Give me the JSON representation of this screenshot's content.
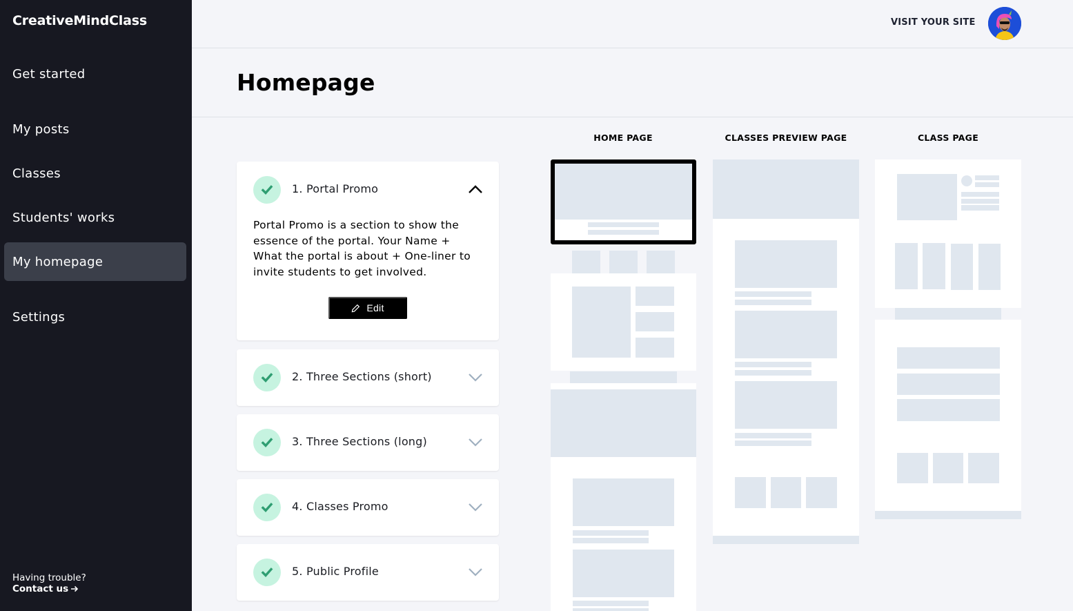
{
  "sidebar": {
    "brand": "CreativeMindClass",
    "items": [
      {
        "label": "Get started",
        "active": false
      },
      {
        "label": "My posts",
        "active": false
      },
      {
        "label": "Classes",
        "active": false
      },
      {
        "label": "Students' works",
        "active": false
      },
      {
        "label": "My homepage",
        "active": true
      },
      {
        "label": "Settings",
        "active": false
      }
    ],
    "help_text": "Having trouble?",
    "contact_label": "Contact us"
  },
  "topbar": {
    "visit_site_label": "VISIT YOUR SITE",
    "avatar_alt": "User avatar"
  },
  "page": {
    "title": "Homepage"
  },
  "sections": [
    {
      "title": "1. Portal Promo",
      "completed": true,
      "expanded": true,
      "description": "Portal Promo is a section to show the essence of the portal. Your Name + What the portal is about + One-liner to invite students to get involved.",
      "edit_label": "Edit"
    },
    {
      "title": "2. Three Sections (short)",
      "completed": true,
      "expanded": false
    },
    {
      "title": "3. Three Sections (long)",
      "completed": true,
      "expanded": false
    },
    {
      "title": "4. Classes Promo",
      "completed": true,
      "expanded": false
    },
    {
      "title": "5. Public Profile",
      "completed": true,
      "expanded": false
    }
  ],
  "previews": {
    "columns": [
      {
        "label": "HOME PAGE"
      },
      {
        "label": "CLASSES PREVIEW PAGE"
      },
      {
        "label": "CLASS PAGE"
      }
    ],
    "selected_block": "Portal Promo"
  },
  "colors": {
    "sidebar_bg": "#171821",
    "sidebar_active": "#3b3f4a",
    "check_bg": "#c6f3e0",
    "check_fg": "#2f9e72",
    "placeholder": "#e0e7ef",
    "page_bg": "#f4f5f9"
  }
}
